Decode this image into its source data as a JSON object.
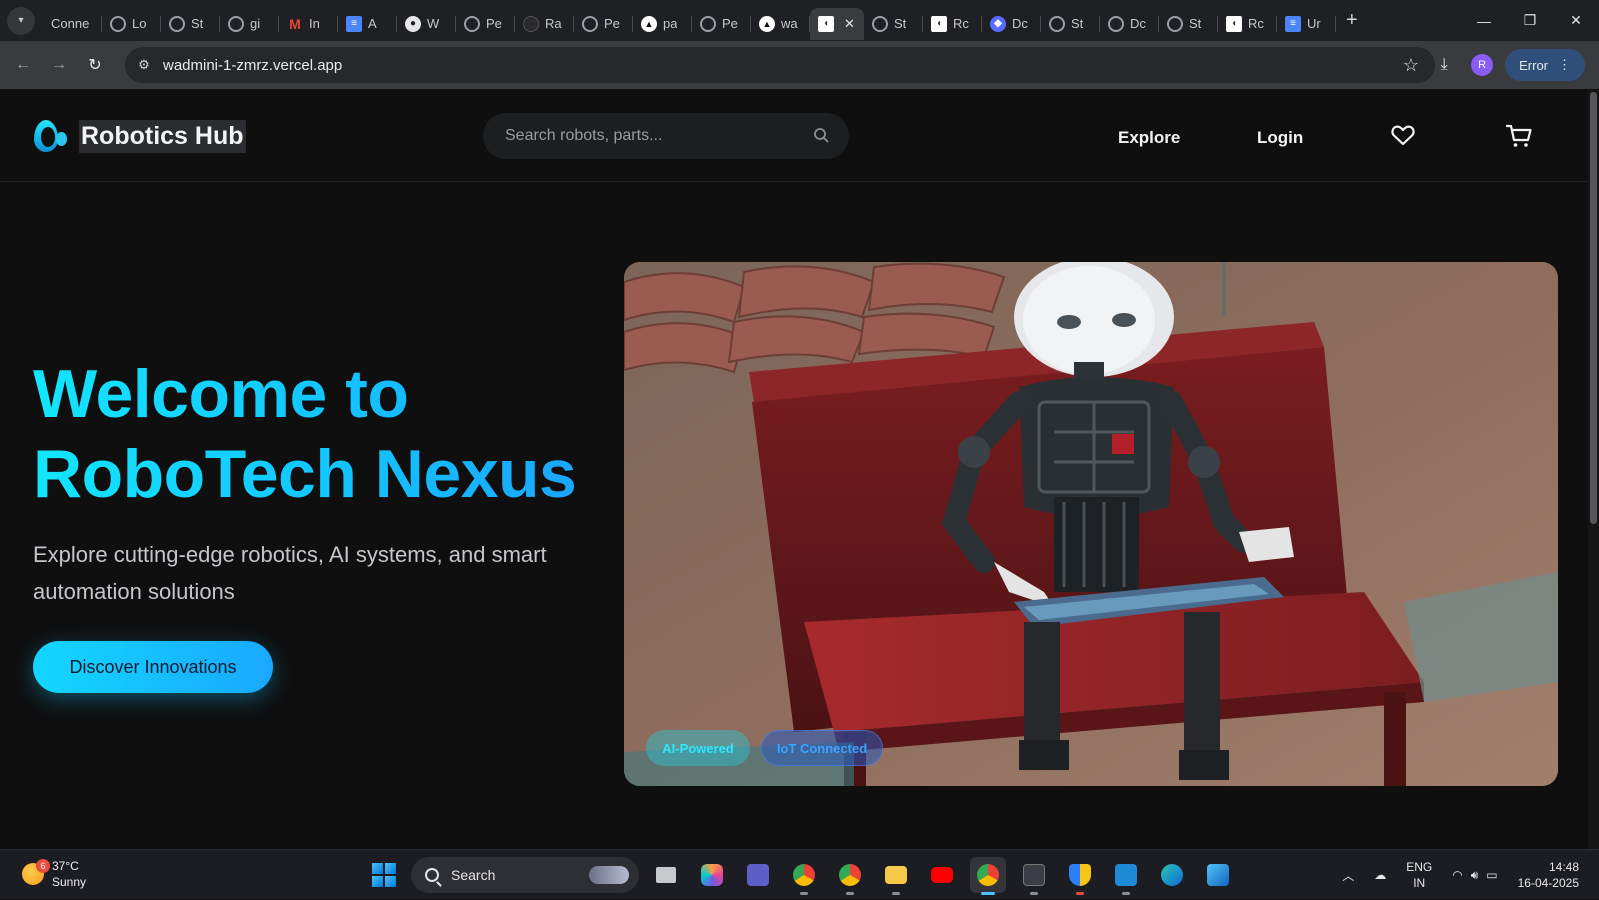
{
  "browser": {
    "tabs": [
      {
        "label": "Conne",
        "favicon": "plain"
      },
      {
        "label": "Lo",
        "favicon": "openai-icon"
      },
      {
        "label": "St",
        "favicon": "openai-icon"
      },
      {
        "label": "gi",
        "favicon": "openai-icon"
      },
      {
        "label": "In",
        "favicon": "gmail-icon"
      },
      {
        "label": "A",
        "favicon": "docs-icon"
      },
      {
        "label": "W",
        "favicon": "github-icon"
      },
      {
        "label": "Pe",
        "favicon": "openai-icon"
      },
      {
        "label": "Ra",
        "favicon": "loading-icon"
      },
      {
        "label": "Pe",
        "favicon": "openai-icon"
      },
      {
        "label": "pa",
        "favicon": "vercel-icon"
      },
      {
        "label": "Pe",
        "favicon": "openai-icon"
      },
      {
        "label": "wa",
        "favicon": "vercel-icon"
      },
      {
        "label": "",
        "favicon": "site-icon",
        "active": true
      },
      {
        "label": "St",
        "favicon": "openai-icon"
      },
      {
        "label": "Rc",
        "favicon": "site-icon"
      },
      {
        "label": "Dc",
        "favicon": "deepseek-icon"
      },
      {
        "label": "St",
        "favicon": "openai-icon"
      },
      {
        "label": "Dc",
        "favicon": "openai-icon"
      },
      {
        "label": "St",
        "favicon": "openai-icon"
      },
      {
        "label": "Rc",
        "favicon": "site-icon"
      },
      {
        "label": "Ur",
        "favicon": "docs-icon"
      }
    ],
    "url": "wadmini-1-zmrz.vercel.app",
    "profile_initial": "R",
    "error_label": "Error"
  },
  "site": {
    "brand": "Robotics Hub",
    "search_placeholder": "Search robots, parts...",
    "nav": {
      "explore": "Explore",
      "login": "Login"
    },
    "hero": {
      "title_line1": "Welcome to",
      "title_line2": "RoboTech Nexus",
      "subtitle": "Explore cutting-edge robotics, AI systems, and smart automation solutions",
      "cta": "Discover Innovations"
    },
    "image_chips": [
      "AI-Powered",
      "IoT Connected"
    ],
    "accent_color": "#13d2ff"
  },
  "taskbar": {
    "weather_temp": "37°C",
    "weather_desc": "Sunny",
    "weather_badge": "6",
    "search_label": "Search",
    "lang_top": "ENG",
    "lang_bottom": "IN",
    "time": "14:48",
    "date": "16-04-2025"
  }
}
